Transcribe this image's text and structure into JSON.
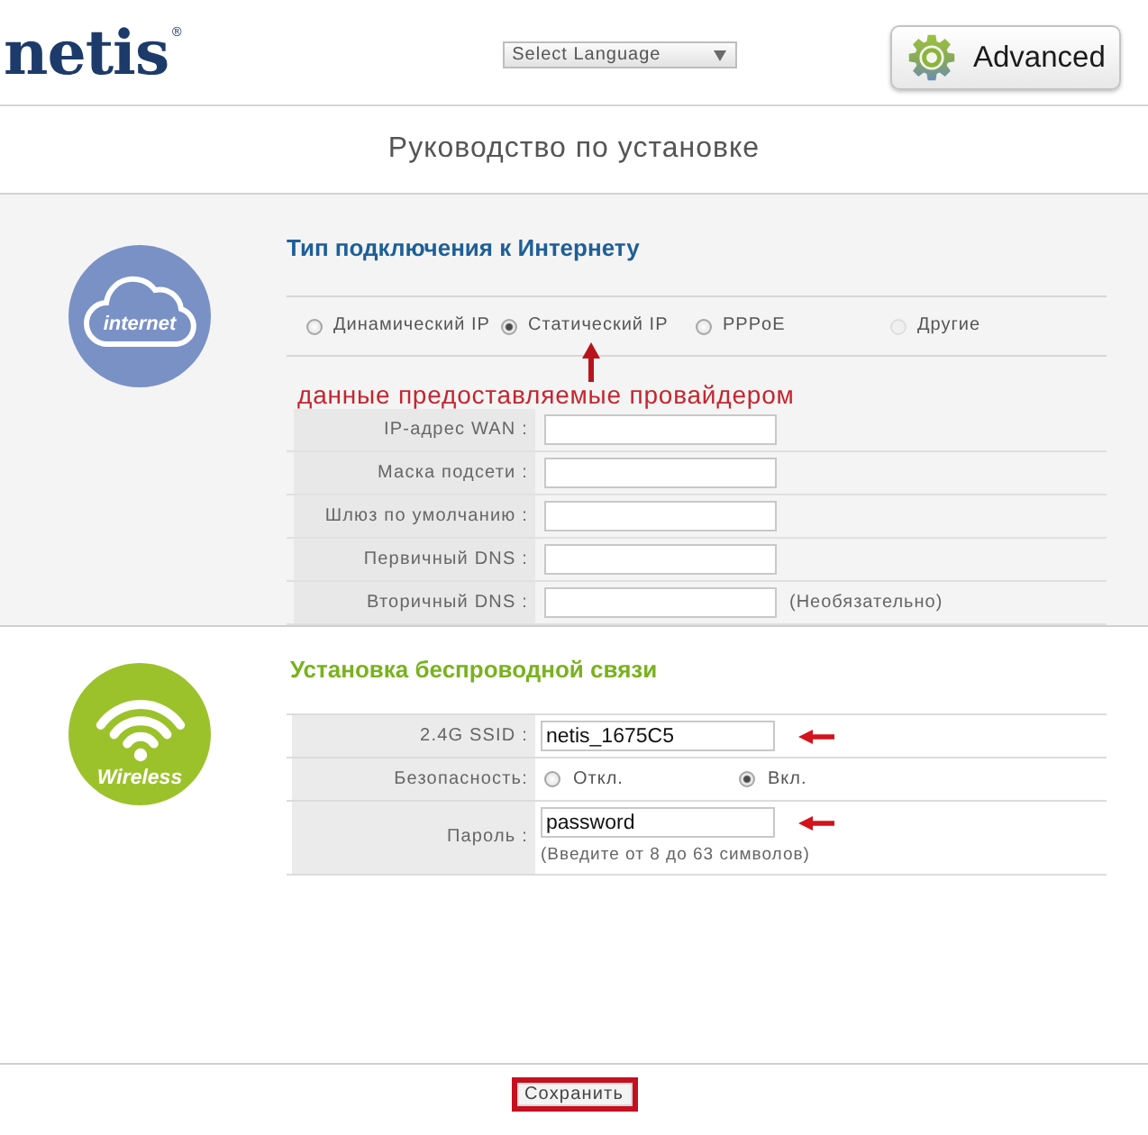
{
  "header": {
    "logo": "netis$^{®}$",
    "language_select": "Select Language",
    "advanced_button": "Advanced"
  },
  "title": "Руководство по установке",
  "internet": {
    "heading": "Тип подключения к Интернету",
    "badge": "internet",
    "connection_types": [
      {
        "label": "Динамический IP",
        "selected": false,
        "disabled": false
      },
      {
        "label": "Статический IP",
        "selected": true,
        "disabled": false
      },
      {
        "label": "PPPoE",
        "selected": false,
        "disabled": false
      },
      {
        "label": "Другие",
        "selected": false,
        "disabled": true
      }
    ],
    "annotation": "данные предоставляемые провайдером",
    "fields": [
      {
        "label": "IP-адрес WAN :"
      },
      {
        "label": "Маска подсети :"
      },
      {
        "label": "Шлюз по умолчанию :"
      },
      {
        "label": "Первичный DNS :"
      },
      {
        "label": "Вторичный DNS :",
        "note": "(Необязательно)"
      }
    ]
  },
  "wireless": {
    "heading": "Установка беспроводной связи",
    "badge": "Wireless",
    "rows": [
      {
        "kind": "text",
        "label": "2.4G SSID :",
        "value": "netis_1675C5",
        "arrow": true
      },
      {
        "kind": "radio",
        "label": "Безопасность:",
        "arrow": false,
        "options": [
          {
            "label": "Откл.",
            "selected": false
          },
          {
            "label": "Вкл.",
            "selected": true
          }
        ]
      },
      {
        "kind": "text",
        "label": "Пароль :",
        "value": "password",
        "hint": "(Введите от 8 до 63 символов)",
        "arrow": true
      }
    ]
  },
  "save_button": {
    "label": "Сохранить",
    "highlighted": true
  }
}
